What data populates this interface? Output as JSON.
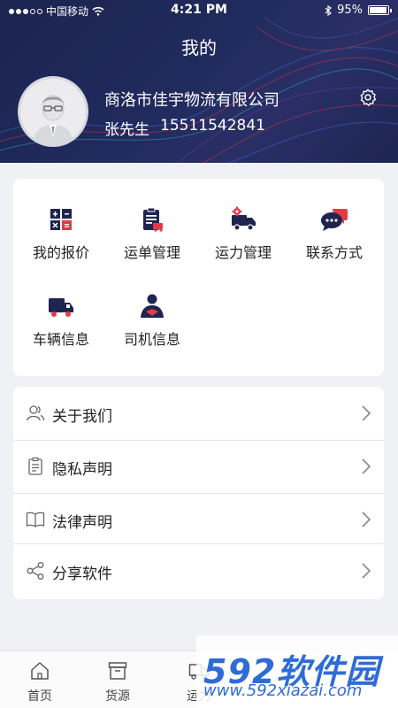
{
  "statusbar": {
    "carrier": "中国移动",
    "time": "4:21 PM",
    "battery": "95%"
  },
  "header": {
    "title": "我的",
    "company": "商洛市佳宇物流有限公司",
    "name": "张先生",
    "phone": "15511542841"
  },
  "grid": [
    {
      "label": "我的报价",
      "icon": "calculator-icon"
    },
    {
      "label": "运单管理",
      "icon": "waybill-icon"
    },
    {
      "label": "运力管理",
      "icon": "truck-gear-icon"
    },
    {
      "label": "联系方式",
      "icon": "chat-bubbles-icon"
    },
    {
      "label": "车辆信息",
      "icon": "truck-icon"
    },
    {
      "label": "司机信息",
      "icon": "driver-icon"
    }
  ],
  "list": [
    {
      "label": "关于我们",
      "icon": "users-icon"
    },
    {
      "label": "隐私声明",
      "icon": "clipboard-icon"
    },
    {
      "label": "法律声明",
      "icon": "book-icon"
    },
    {
      "label": "分享软件",
      "icon": "share-icon"
    }
  ],
  "tabs": [
    {
      "label": "首页",
      "icon": "home-icon"
    },
    {
      "label": "货源",
      "icon": "cargo-box-icon"
    },
    {
      "label": "运力",
      "icon": "truck-icon"
    }
  ],
  "watermark": {
    "brand": "592软件园",
    "url": "www.592xiazai.com"
  },
  "colors": {
    "header_bg": "#1f2856",
    "icon_navy": "#1f2550",
    "icon_red": "#e33b46",
    "page_bg": "#f0f1f5"
  }
}
